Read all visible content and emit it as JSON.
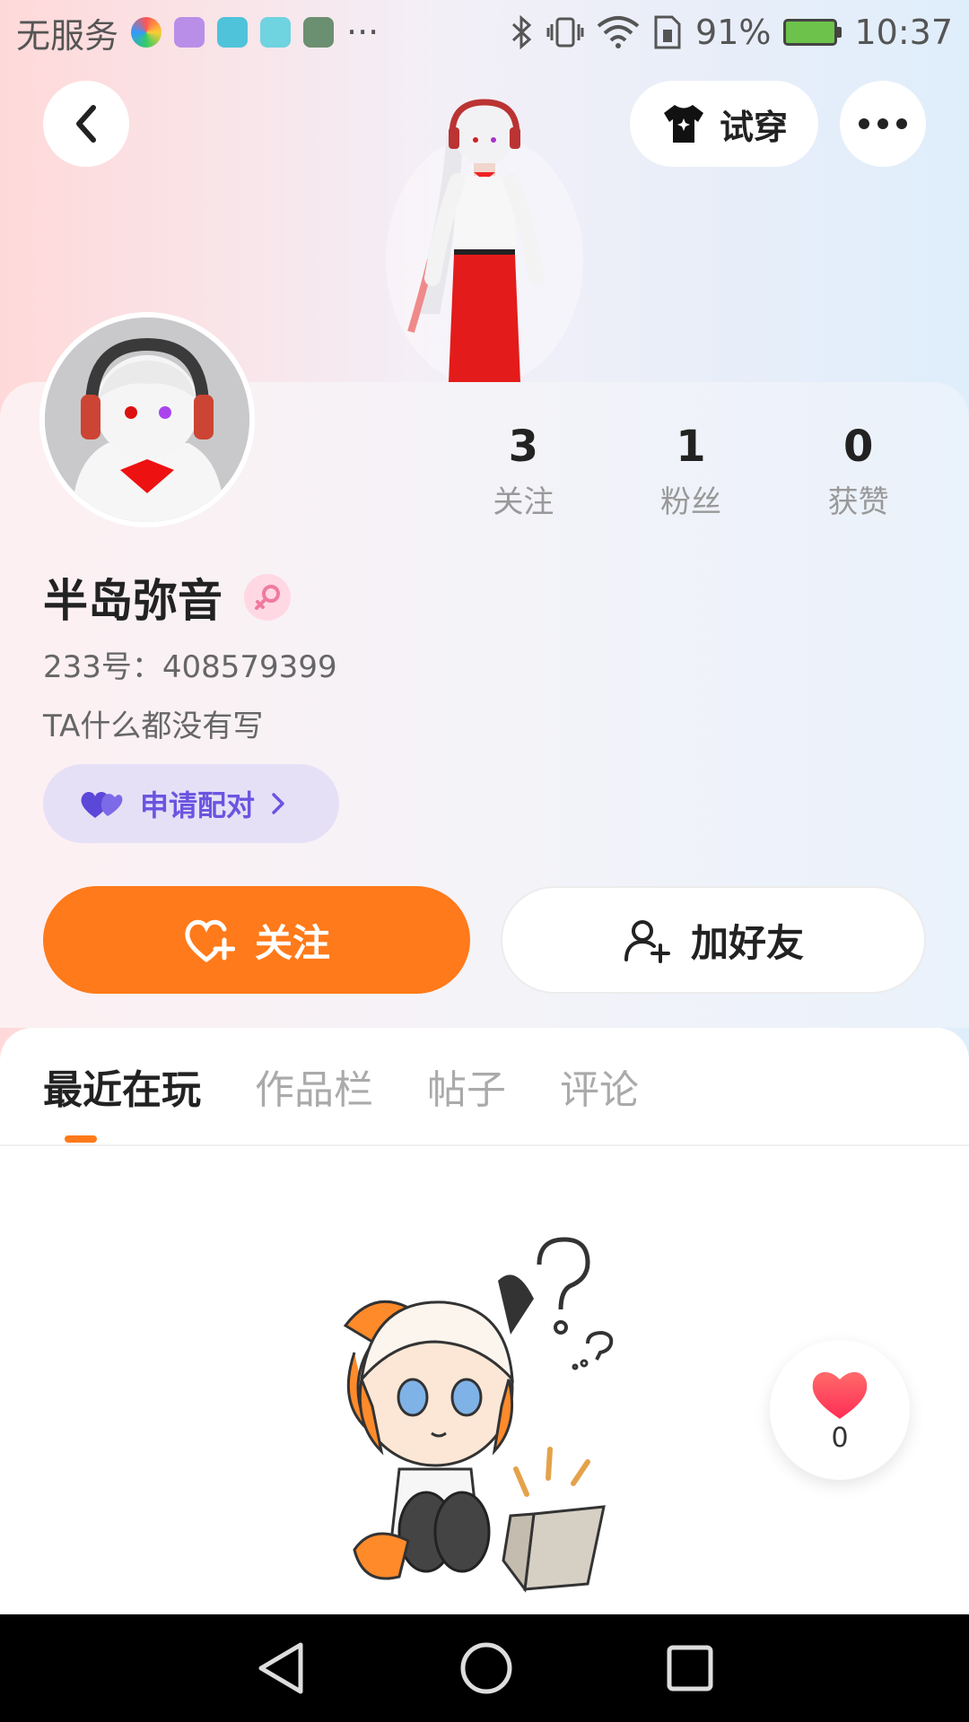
{
  "status_bar": {
    "carrier": "无服务",
    "more": "···",
    "battery_percent": "91%",
    "time": "10:37"
  },
  "top_bar": {
    "try_on_label": "试穿"
  },
  "profile": {
    "stats": [
      {
        "value": "3",
        "label": "关注"
      },
      {
        "value": "1",
        "label": "粉丝"
      },
      {
        "value": "0",
        "label": "获赞"
      }
    ],
    "nickname": "半岛弥音",
    "user_id": "233号：408579399",
    "bio": "TA什么都没有写",
    "pair_label": "申请配对"
  },
  "actions": {
    "follow_label": "关注",
    "add_friend_label": "加好友"
  },
  "tabs": [
    "最近在玩",
    "作品栏",
    "帖子",
    "评论"
  ],
  "active_tab_index": 0,
  "like_fab": {
    "count": "0"
  },
  "colors": {
    "accent": "#ff7a1a",
    "pair_text": "#6a55e0",
    "pair_bg": "#e6e0f7"
  }
}
